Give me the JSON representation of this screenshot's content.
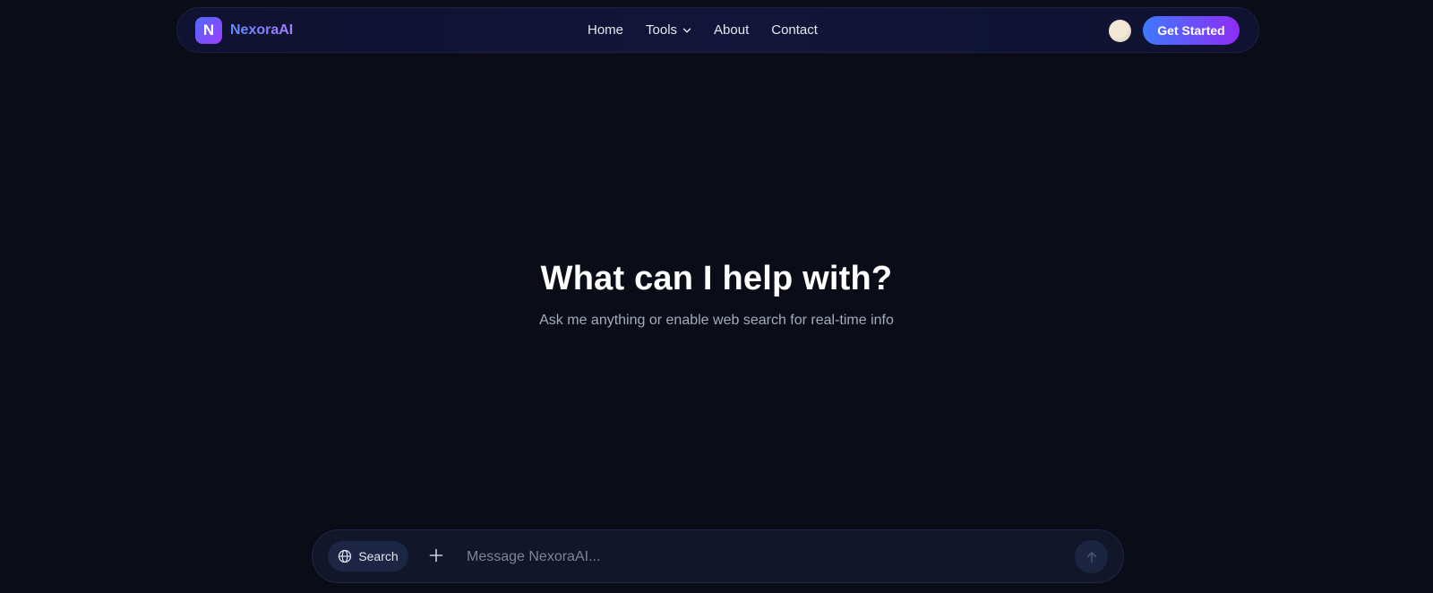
{
  "nav": {
    "brand_letter": "N",
    "brand_name": "NexoraAI",
    "links": [
      {
        "label": "Home"
      },
      {
        "label": "Tools",
        "icon": "chevron-down-icon"
      },
      {
        "label": "About"
      },
      {
        "label": "Contact"
      }
    ],
    "theme_icon": "sun-icon",
    "cta_label": "Get Started"
  },
  "hero": {
    "title": "What can I help with?",
    "subtitle": "Ask me anything or enable web search for real-time info"
  },
  "composer": {
    "search_label": "Search",
    "search_icon": "globe-icon",
    "attach_icon": "plus-icon",
    "placeholder": "Message NexoraAI...",
    "send_icon": "arrow-up-icon"
  },
  "colors": {
    "background": "#0a0d17",
    "accent_start": "#3f78ff",
    "accent_end": "#8f2cf5"
  }
}
